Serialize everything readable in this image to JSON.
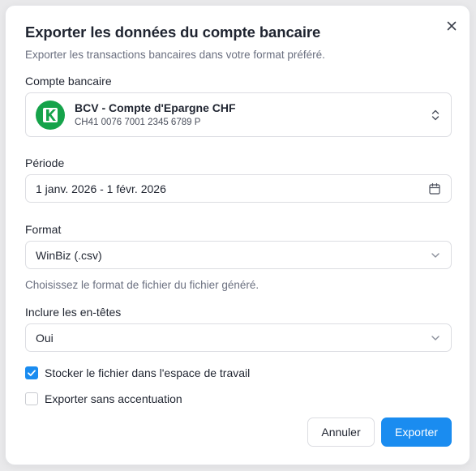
{
  "dialog": {
    "title": "Exporter les données du compte bancaire",
    "subtitle": "Exporter les transactions bancaires dans votre format préféré."
  },
  "account": {
    "label": "Compte bancaire",
    "name": "BCV - Compte d'Epargne CHF",
    "iban": "CH41 0076 7001 2345 6789 P",
    "logo_color": "#15a34a"
  },
  "period": {
    "label": "Période",
    "value": "1 janv. 2026 - 1 févr. 2026"
  },
  "format": {
    "label": "Format",
    "value": "WinBiz (.csv)",
    "helper": "Choisissez le format de fichier du fichier généré."
  },
  "headers": {
    "label": "Inclure les en-têtes",
    "value": "Oui"
  },
  "options": {
    "store_label": "Stocker le fichier dans l'espace de travail",
    "store_checked": true,
    "no_accents_label": "Exporter sans accentuation",
    "no_accents_checked": false
  },
  "buttons": {
    "cancel": "Annuler",
    "export": "Exporter"
  },
  "colors": {
    "accent": "#1a8cf0",
    "text": "#1f2430",
    "muted": "#6b7080"
  }
}
